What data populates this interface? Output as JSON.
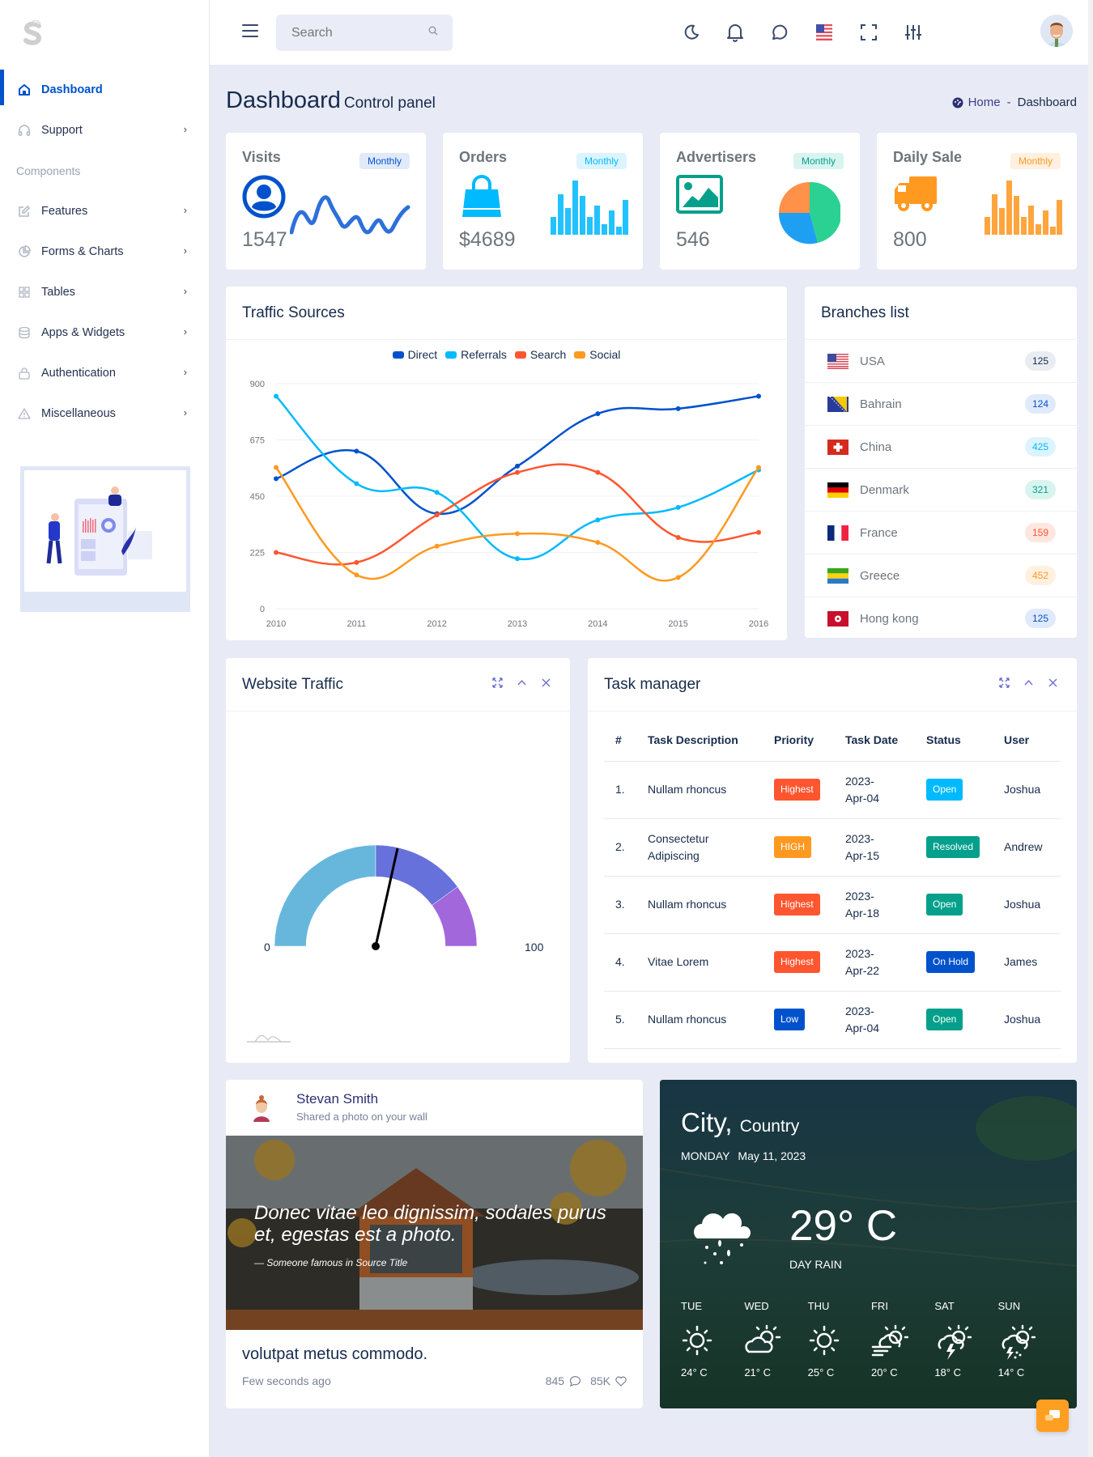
{
  "header": {
    "search_placeholder": "Search",
    "icons": [
      "moon-icon",
      "bell-icon",
      "chat-icon",
      "us-flag-icon",
      "fullscreen-icon",
      "sliders-icon",
      "user-avatar"
    ]
  },
  "sidebar": {
    "items": [
      {
        "label": "Dashboard",
        "icon": "home-icon",
        "active": true
      },
      {
        "label": "Support",
        "icon": "headphones-icon",
        "chevron": true
      }
    ],
    "section_heading": "Components",
    "component_items": [
      {
        "label": "Features",
        "icon": "edit-icon"
      },
      {
        "label": "Forms & Charts",
        "icon": "pie-chart-icon"
      },
      {
        "label": "Tables",
        "icon": "grid-icon"
      },
      {
        "label": "Apps & Widgets",
        "icon": "database-icon"
      },
      {
        "label": "Authentication",
        "icon": "lock-icon"
      },
      {
        "label": "Miscellaneous",
        "icon": "warning-icon"
      }
    ]
  },
  "page": {
    "title": "Dashboard",
    "subtitle": "Control panel",
    "breadcrumb": {
      "home": "Home",
      "separator": "-",
      "current": "Dashboard"
    }
  },
  "stats": [
    {
      "title": "Visits",
      "badge": "Monthly",
      "value": "1547",
      "icon": "user-circle-icon",
      "color": "#0052cc"
    },
    {
      "title": "Orders",
      "badge": "Monthly",
      "value": "$4689",
      "icon": "shopping-bag-icon",
      "color": "#00baff"
    },
    {
      "title": "Advertisers",
      "badge": "Monthly",
      "value": "546",
      "icon": "image-icon",
      "color": "#04a08b"
    },
    {
      "title": "Daily Sale",
      "badge": "Monthly",
      "value": "800",
      "icon": "truck-icon",
      "color": "#ff9920"
    }
  ],
  "traffic": {
    "title": "Traffic Sources"
  },
  "chart_data": [
    {
      "type": "line",
      "title": "Traffic Sources",
      "x": [
        "2010",
        "2011",
        "2012",
        "2013",
        "2014",
        "2015",
        "2016"
      ],
      "ylim": [
        0,
        900
      ],
      "yticks": [
        0,
        225,
        450,
        675,
        900
      ],
      "grid": true,
      "legend": "top-center",
      "series": [
        {
          "name": "Direct",
          "color": "#0052cc",
          "values": [
            520,
            630,
            380,
            570,
            780,
            800,
            850
          ]
        },
        {
          "name": "Referrals",
          "color": "#00baff",
          "values": [
            850,
            500,
            465,
            200,
            355,
            405,
            555
          ]
        },
        {
          "name": "Search",
          "color": "#ff562f",
          "values": [
            225,
            185,
            375,
            545,
            545,
            285,
            305
          ]
        },
        {
          "name": "Social",
          "color": "#ff9920",
          "values": [
            565,
            135,
            250,
            300,
            265,
            125,
            565
          ]
        }
      ]
    },
    {
      "type": "gauge",
      "title": "Website Traffic",
      "min": 0,
      "max": 100,
      "value": 57,
      "bands": [
        {
          "from": 0,
          "to": 50,
          "color": "#67b7dc"
        },
        {
          "from": 50,
          "to": 80,
          "color": "#6771dc"
        },
        {
          "from": 80,
          "to": 100,
          "color": "#a367dc"
        }
      ],
      "min_label": "0",
      "max_label": "100"
    }
  ],
  "branches": {
    "title": "Branches list",
    "items": [
      {
        "name": "USA",
        "count": "125",
        "flag": "us-flag-icon",
        "fg": "#172b4c",
        "bg": "#e9ecf1"
      },
      {
        "name": "Bahrain",
        "count": "124",
        "flag": "bosnia-flag-icon",
        "fg": "#0052cc",
        "bg": "#e1eafa"
      },
      {
        "name": "China",
        "count": "425",
        "flag": "swiss-flag-icon",
        "fg": "#00baff",
        "bg": "#dcf4ff"
      },
      {
        "name": "Denmark",
        "count": "321",
        "flag": "germany-flag-icon",
        "fg": "#04a08b",
        "bg": "#d9f4ef"
      },
      {
        "name": "France",
        "count": "159",
        "flag": "france-flag-icon",
        "fg": "#ff562f",
        "bg": "#ffe6e0"
      },
      {
        "name": "Greece",
        "count": "452",
        "flag": "gabon-flag-icon",
        "fg": "#ff9920",
        "bg": "#fff0df"
      },
      {
        "name": "Hong kong",
        "count": "125",
        "flag": "hongkong-flag-icon",
        "fg": "#0052cc",
        "bg": "#e1eafa"
      }
    ]
  },
  "website_traffic": {
    "title": "Website Traffic"
  },
  "tasks": {
    "title": "Task manager",
    "columns": [
      "#",
      "Task Description",
      "Priority",
      "Task Date",
      "Status",
      "User"
    ],
    "rows": [
      {
        "num": "1.",
        "desc": "Nullam rhoncus",
        "priority": "Highest",
        "priority_color": "#ff562f",
        "date1": "2023-",
        "date2": "Apr-04",
        "status": "Open",
        "status_color": "#00baff",
        "user": "Joshua"
      },
      {
        "num": "2.",
        "desc": "Consectetur Adipiscing",
        "priority": "HIGH",
        "priority_color": "#ff9920",
        "date1": "2023-",
        "date2": "Apr-15",
        "status": "Resolved",
        "status_color": "#04a08b",
        "user": "Andrew"
      },
      {
        "num": "3.",
        "desc": "Nullam rhoncus",
        "priority": "Highest",
        "priority_color": "#ff562f",
        "date1": "2023-",
        "date2": "Apr-18",
        "status": "Open",
        "status_color": "#04a08b",
        "user": "Joshua"
      },
      {
        "num": "4.",
        "desc": "Vitae Lorem",
        "priority": "Highest",
        "priority_color": "#ff562f",
        "date1": "2023-",
        "date2": "Apr-22",
        "status": "On Hold",
        "status_color": "#0052cc",
        "user": "James"
      },
      {
        "num": "5.",
        "desc": "Nullam rhoncus",
        "priority": "Low",
        "priority_color": "#0052cc",
        "date1": "2023-",
        "date2": "Apr-04",
        "status": "Open",
        "status_color": "#04a08b",
        "user": "Joshua"
      }
    ]
  },
  "post": {
    "author": "Stevan Smith",
    "action": "Shared a photo on your wall",
    "quote": "Donec vitae leo dignissim, sodales purus et, egestas est a photo.",
    "cite": "— Someone famous in Source Title",
    "title": "volutpat metus commodo.",
    "time": "Few seconds ago",
    "comments": "845",
    "likes": "85K"
  },
  "weather": {
    "city": "City,",
    "country": "Country",
    "day": "MONDAY",
    "date": "May 11, 2023",
    "temp": "29° C",
    "condition": "DAY RAIN",
    "forecast": [
      {
        "day": "TUE",
        "temp": "24° C",
        "icon": "sun-icon"
      },
      {
        "day": "WED",
        "temp": "21° C",
        "icon": "partly-cloudy-icon"
      },
      {
        "day": "THU",
        "temp": "25° C",
        "icon": "sun-icon"
      },
      {
        "day": "FRI",
        "temp": "20° C",
        "icon": "windy-cloud-icon"
      },
      {
        "day": "SAT",
        "temp": "18° C",
        "icon": "thunder-icon"
      },
      {
        "day": "SUN",
        "temp": "14° C",
        "icon": "thunder-rain-icon"
      }
    ]
  },
  "colors": {
    "primary": "#0052cc",
    "info": "#00baff",
    "success": "#04a08b",
    "warning": "#ff9920",
    "danger": "#ff562f"
  }
}
